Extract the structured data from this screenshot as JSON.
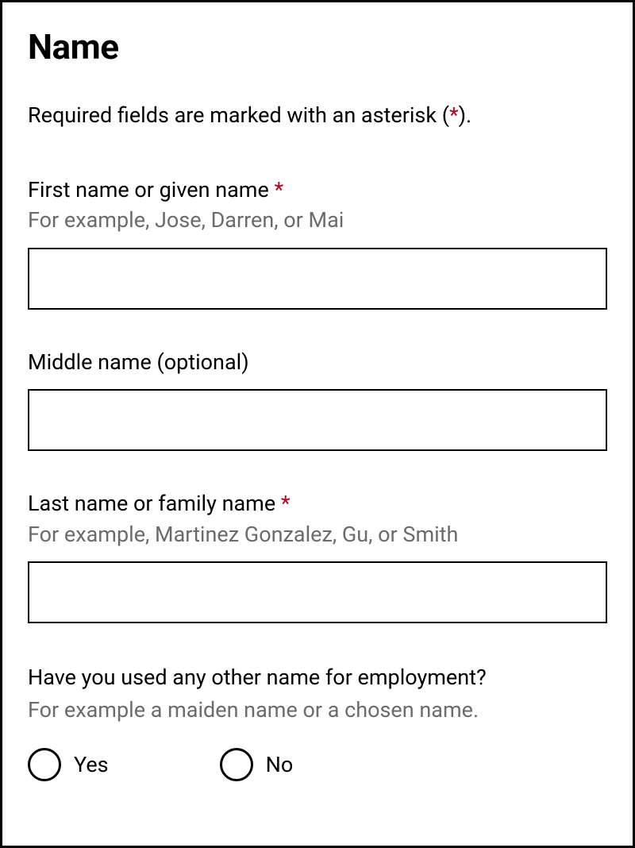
{
  "form": {
    "title": "Name",
    "required_note_prefix": "Required fields are marked with an asterisk (",
    "required_note_asterisk": "*",
    "required_note_suffix": ").",
    "fields": {
      "first_name": {
        "label": "First name or given name ",
        "asterisk": "*",
        "hint": "For example, Jose, Darren, or Mai",
        "value": ""
      },
      "middle_name": {
        "label": "Middle name (optional)",
        "value": ""
      },
      "last_name": {
        "label": "Last name or family name ",
        "asterisk": "*",
        "hint": "For example, Martinez Gonzalez, Gu, or Smith",
        "value": ""
      }
    },
    "question": {
      "text": "Have you used any other name for employment?",
      "hint": "For example a maiden name or a chosen name.",
      "options": {
        "yes": "Yes",
        "no": "No"
      }
    }
  }
}
